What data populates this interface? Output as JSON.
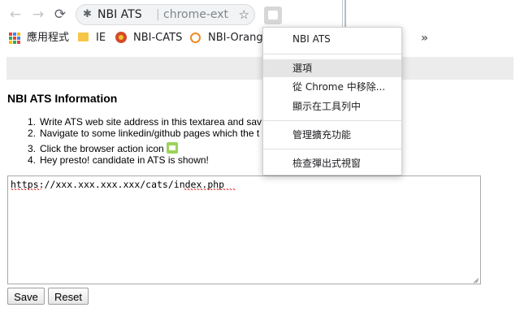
{
  "toolbar": {
    "back_glyph": "←",
    "forward_glyph": "→",
    "reload_glyph": "⟳",
    "extension_name": "NBI ATS",
    "separator": "|",
    "url_text": "chrome-ext...",
    "star_glyph": "☆"
  },
  "bookmarks": {
    "apps_label": "應用程式",
    "items": [
      "IE",
      "NBI-CATS",
      "NBI-Orange"
    ],
    "more_glyph": "»",
    "apps_colors": [
      "#ea4335",
      "#4285f4",
      "#fbbc05",
      "#34a853",
      "#ea4335",
      "#4285f4",
      "#fbbc05",
      "#34a853",
      "#ea4335"
    ]
  },
  "popup": {
    "title": "NBI ATS Information",
    "steps": [
      {
        "num": "1.",
        "text": "Write ATS web site address in this textarea and sav"
      },
      {
        "num": "2.",
        "text": "Navigate to some linkedin/github pages which the t"
      },
      {
        "num": "3.",
        "text": "Click the browser action icon"
      },
      {
        "num": "4.",
        "text": "Hey presto! candidate in ATS is shown!"
      }
    ],
    "textarea_value": "https://xxx.xxx.xxx.xxx/cats/index.php",
    "save_label": "Save",
    "reset_label": "Reset"
  },
  "context_menu": {
    "header": "NBI ATS",
    "items": [
      "選項",
      "從 Chrome 中移除...",
      "顯示在工具列中"
    ],
    "manage": "管理擴充功能",
    "inspect": "檢查彈出式視窗",
    "active_index": 0
  },
  "colors": {
    "accent_icon": "#9bd35a",
    "menu_hover": "#e5e5e5"
  }
}
